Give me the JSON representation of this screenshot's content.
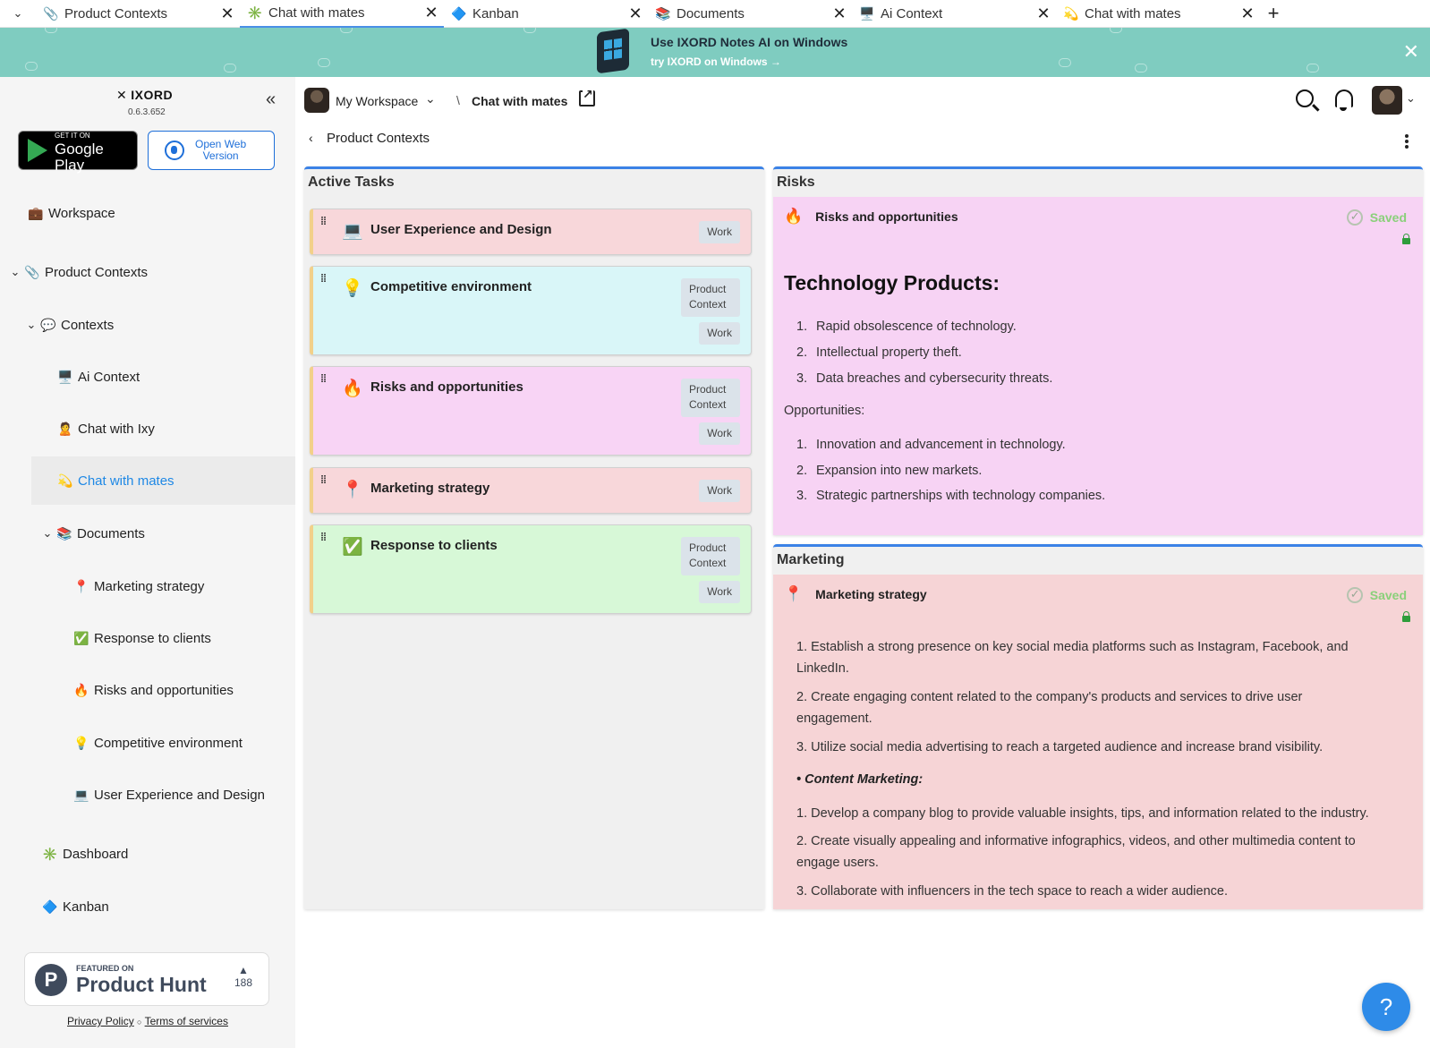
{
  "tabs": [
    {
      "icon": "📎",
      "label": "Product Contexts",
      "active": false
    },
    {
      "icon": "✳️",
      "label": "Chat with mates",
      "active": true
    },
    {
      "icon": "🔷",
      "label": "Kanban",
      "active": false
    },
    {
      "icon": "📚",
      "label": "Documents",
      "active": false
    },
    {
      "icon": "🖥️",
      "label": "Ai Context",
      "active": false
    },
    {
      "icon": "💫",
      "label": "Chat with mates",
      "active": false
    }
  ],
  "tab_add": "+",
  "banner": {
    "title": "Use IXORD Notes AI on Windows",
    "subtitle": "try IXORD on Windows",
    "arrow": "→",
    "close": "✕"
  },
  "sidebar": {
    "logo_mark": "✕",
    "logo_text": "IXORD",
    "version": "0.6.3.652",
    "collapse": "«",
    "google_play": {
      "line1": "GET IT ON",
      "line2": "Google Play"
    },
    "web_version": {
      "line1": "Open Web",
      "line2": "Version"
    },
    "items": [
      {
        "icon": "💼",
        "label": "Workspace",
        "chev": ""
      },
      {
        "icon": "📎",
        "label": "Product Contexts",
        "chev": "⌄"
      },
      {
        "icon": "💬",
        "label": "Contexts",
        "chev": "⌄"
      },
      {
        "icon": "🖥️",
        "label": "Ai Context",
        "chev": ""
      },
      {
        "icon": "🙎",
        "label": "Chat with Ixy",
        "chev": ""
      },
      {
        "icon": "💫",
        "label": "Chat with mates",
        "chev": ""
      },
      {
        "icon": "📚",
        "label": "Documents",
        "chev": "⌄"
      },
      {
        "icon": "📍",
        "label": "Marketing strategy",
        "chev": ""
      },
      {
        "icon": "✅",
        "label": "Response to clients",
        "chev": ""
      },
      {
        "icon": "🔥",
        "label": "Risks and opportunities",
        "chev": ""
      },
      {
        "icon": "💡",
        "label": "Competitive environment",
        "chev": ""
      },
      {
        "icon": "💻",
        "label": "User Experience and Design",
        "chev": ""
      },
      {
        "icon": "✳️",
        "label": "Dashboard",
        "chev": ""
      },
      {
        "icon": "🔷",
        "label": "Kanban",
        "chev": ""
      }
    ],
    "product_hunt": {
      "letter": "P",
      "featured": "FEATURED ON",
      "name": "Product Hunt",
      "votes": "188",
      "up": "▲"
    },
    "legal": {
      "privacy": "Privacy Policy",
      "sep": "○",
      "terms": "Terms of services"
    }
  },
  "topbar": {
    "workspace": "My Workspace",
    "caret": "⌄",
    "separator": "\\",
    "page": "Chat with mates"
  },
  "back": {
    "arrow": "‹",
    "label": "Product Contexts"
  },
  "active_tasks": {
    "title": "Active Tasks",
    "cards": [
      {
        "icon": "💻",
        "title": "User Experience and Design",
        "tags": [
          "Work"
        ],
        "bg": "#f8d7da"
      },
      {
        "icon": "💡",
        "title": "Competitive environment",
        "tags": [
          "Product Context",
          "Work"
        ],
        "bg": "#d9f6f8"
      },
      {
        "icon": "🔥",
        "title": "Risks and opportunities",
        "tags": [
          "Product Context",
          "Work"
        ],
        "bg": "#f8d4f5"
      },
      {
        "icon": "📍",
        "title": "Marketing strategy",
        "tags": [
          "Work"
        ],
        "bg": "#f8d7da"
      },
      {
        "icon": "✅",
        "title": "Response to clients",
        "tags": [
          "Product Context",
          "Work"
        ],
        "bg": "#d7f8d7"
      }
    ]
  },
  "risks": {
    "title": "Risks",
    "bg": "#f7d3f4",
    "note_icon": "🔥",
    "note_title": "Risks and opportunities",
    "saved": "Saved",
    "heading": "Technology Products:",
    "risks_list": [
      "Rapid obsolescence of technology.",
      "Intellectual property theft.",
      "Data breaches and cybersecurity threats."
    ],
    "opps_label": "Opportunities:",
    "opps_list": [
      "Innovation and advancement in technology.",
      "Expansion into new markets.",
      "Strategic partnerships with technology companies."
    ]
  },
  "marketing": {
    "title": "Marketing",
    "bg": "#f6d4d6",
    "note_icon": "📍",
    "note_title": "Marketing strategy",
    "saved": "Saved",
    "items": [
      "1.  Establish a strong presence on key social media platforms such as Instagram, Facebook, and LinkedIn.",
      "2.  Create engaging content related to the company's products and services to drive user engagement.",
      "3.  Utilize social media advertising to reach a targeted audience and increase brand visibility."
    ],
    "subheading": "• Content Marketing:",
    "items2": [
      "1.  Develop a company blog to provide valuable insights, tips, and information related to the industry.",
      "2.  Create visually appealing and informative infographics, videos, and other multimedia content to engage users.",
      "3.  Collaborate with influencers in the tech space to reach a wider audience."
    ]
  },
  "help": "?"
}
